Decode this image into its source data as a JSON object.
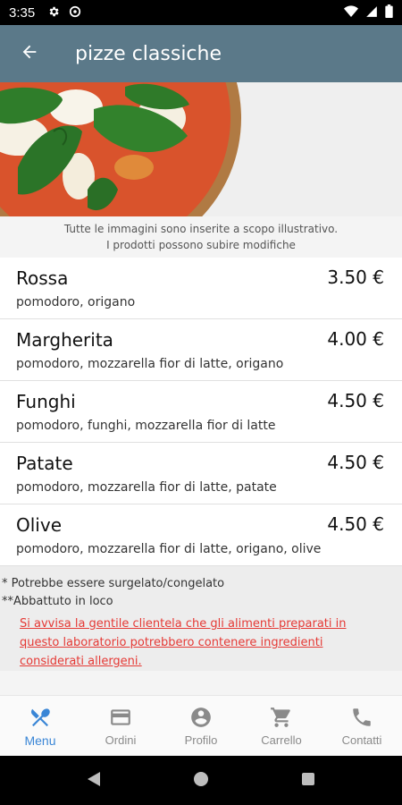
{
  "status_bar": {
    "time": "3:35"
  },
  "app_bar": {
    "title": "pizze classiche"
  },
  "disclaimer": {
    "line1": "Tutte le immagini sono inserite a scopo illustrativo.",
    "line2": "I prodotti possono subire modifiche"
  },
  "menu": {
    "items": [
      {
        "name": "Rossa",
        "price": "3.50 €",
        "description": "pomodoro, origano"
      },
      {
        "name": "Margherita",
        "price": "4.00 €",
        "description": "pomodoro, mozzarella fior di latte, origano"
      },
      {
        "name": "Funghi",
        "price": "4.50 €",
        "description": "pomodoro, funghi, mozzarella fior di latte"
      },
      {
        "name": "Patate",
        "price": "4.50 €",
        "description": "pomodoro, mozzarella fior di latte, patate"
      },
      {
        "name": "Olive",
        "price": "4.50 €",
        "description": "pomodoro, mozzarella fior di latte, origano, olive"
      }
    ]
  },
  "notes": {
    "frozen": "* Potrebbe essere surgelato/congelato",
    "slaughtered": "**Abbattuto in loco",
    "allergen": "Si avvisa la gentile clientela che gli alimenti preparati in questo laboratorio potrebbero contenere ingredienti considerati allergeni."
  },
  "bottom_nav": {
    "items": [
      {
        "label": "Menu",
        "icon": "fork-knife-icon",
        "active": true
      },
      {
        "label": "Ordini",
        "icon": "card-icon",
        "active": false
      },
      {
        "label": "Profilo",
        "icon": "account-circle-icon",
        "active": false
      },
      {
        "label": "Carrello",
        "icon": "cart-icon",
        "active": false
      },
      {
        "label": "Contatti",
        "icon": "phone-icon",
        "active": false
      }
    ]
  },
  "colors": {
    "app_bar": "#5b7989",
    "active_nav": "#3a86d6",
    "allergen_text": "#e53935"
  }
}
